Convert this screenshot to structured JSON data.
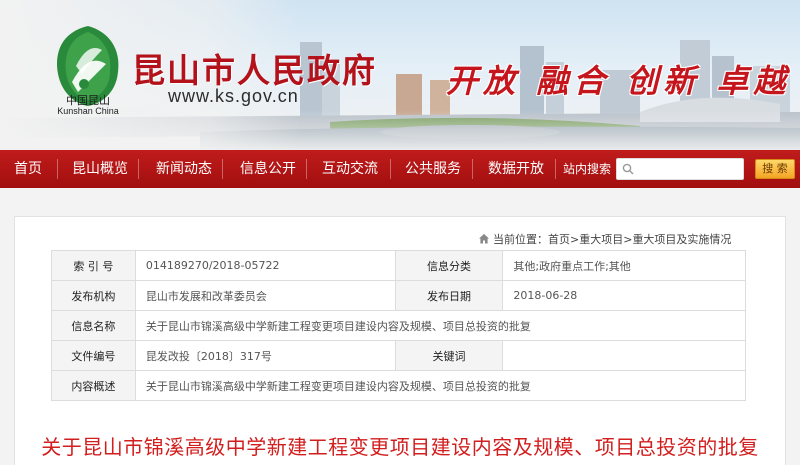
{
  "header": {
    "site_title": "昆山市人民政府",
    "url": "www.ks.gov.cn",
    "logo_cn": "中国昆山",
    "logo_en": "Kunshan China",
    "slogan": "开放 融合 创新 卓越"
  },
  "nav": {
    "items": [
      "首页",
      "昆山概览",
      "新闻动态",
      "信息公开",
      "互动交流",
      "公共服务",
      "数据开放"
    ],
    "search_label": "站内搜索",
    "search_value": "",
    "search_button": "搜 索"
  },
  "breadcrumb": {
    "prefix": "当前位置：",
    "items": [
      "首页",
      "重大项目",
      "重大项目及实施情况"
    ],
    "separator": ">"
  },
  "meta": {
    "index_label": "索 引 号",
    "index_value": "014189270/2018-05722",
    "category_label": "信息分类",
    "category_value": "其他;政府重点工作;其他",
    "publisher_label": "发布机构",
    "publisher_value": "昆山市发展和改革委员会",
    "date_label": "发布日期",
    "date_value": "2018-06-28",
    "name_label": "信息名称",
    "name_value": "关于昆山市锦溪高级中学新建工程变更项目建设内容及规模、项目总投资的批复",
    "docnum_label": "文件编号",
    "docnum_value": "昆发改投〔2018〕317号",
    "keyword_label": "关键词",
    "keyword_value": "",
    "summary_label": "内容概述",
    "summary_value": "关于昆山市锦溪高级中学新建工程变更项目建设内容及规模、项目总投资的批复"
  },
  "document": {
    "title": "关于昆山市锦溪高级中学新建工程变更项目建设内容及规模、项目总投资的批复"
  },
  "colors": {
    "brand_red": "#b3121b",
    "nav_red": "#b01616",
    "title_red": "#d21e1e",
    "search_button": "#f4a524"
  }
}
